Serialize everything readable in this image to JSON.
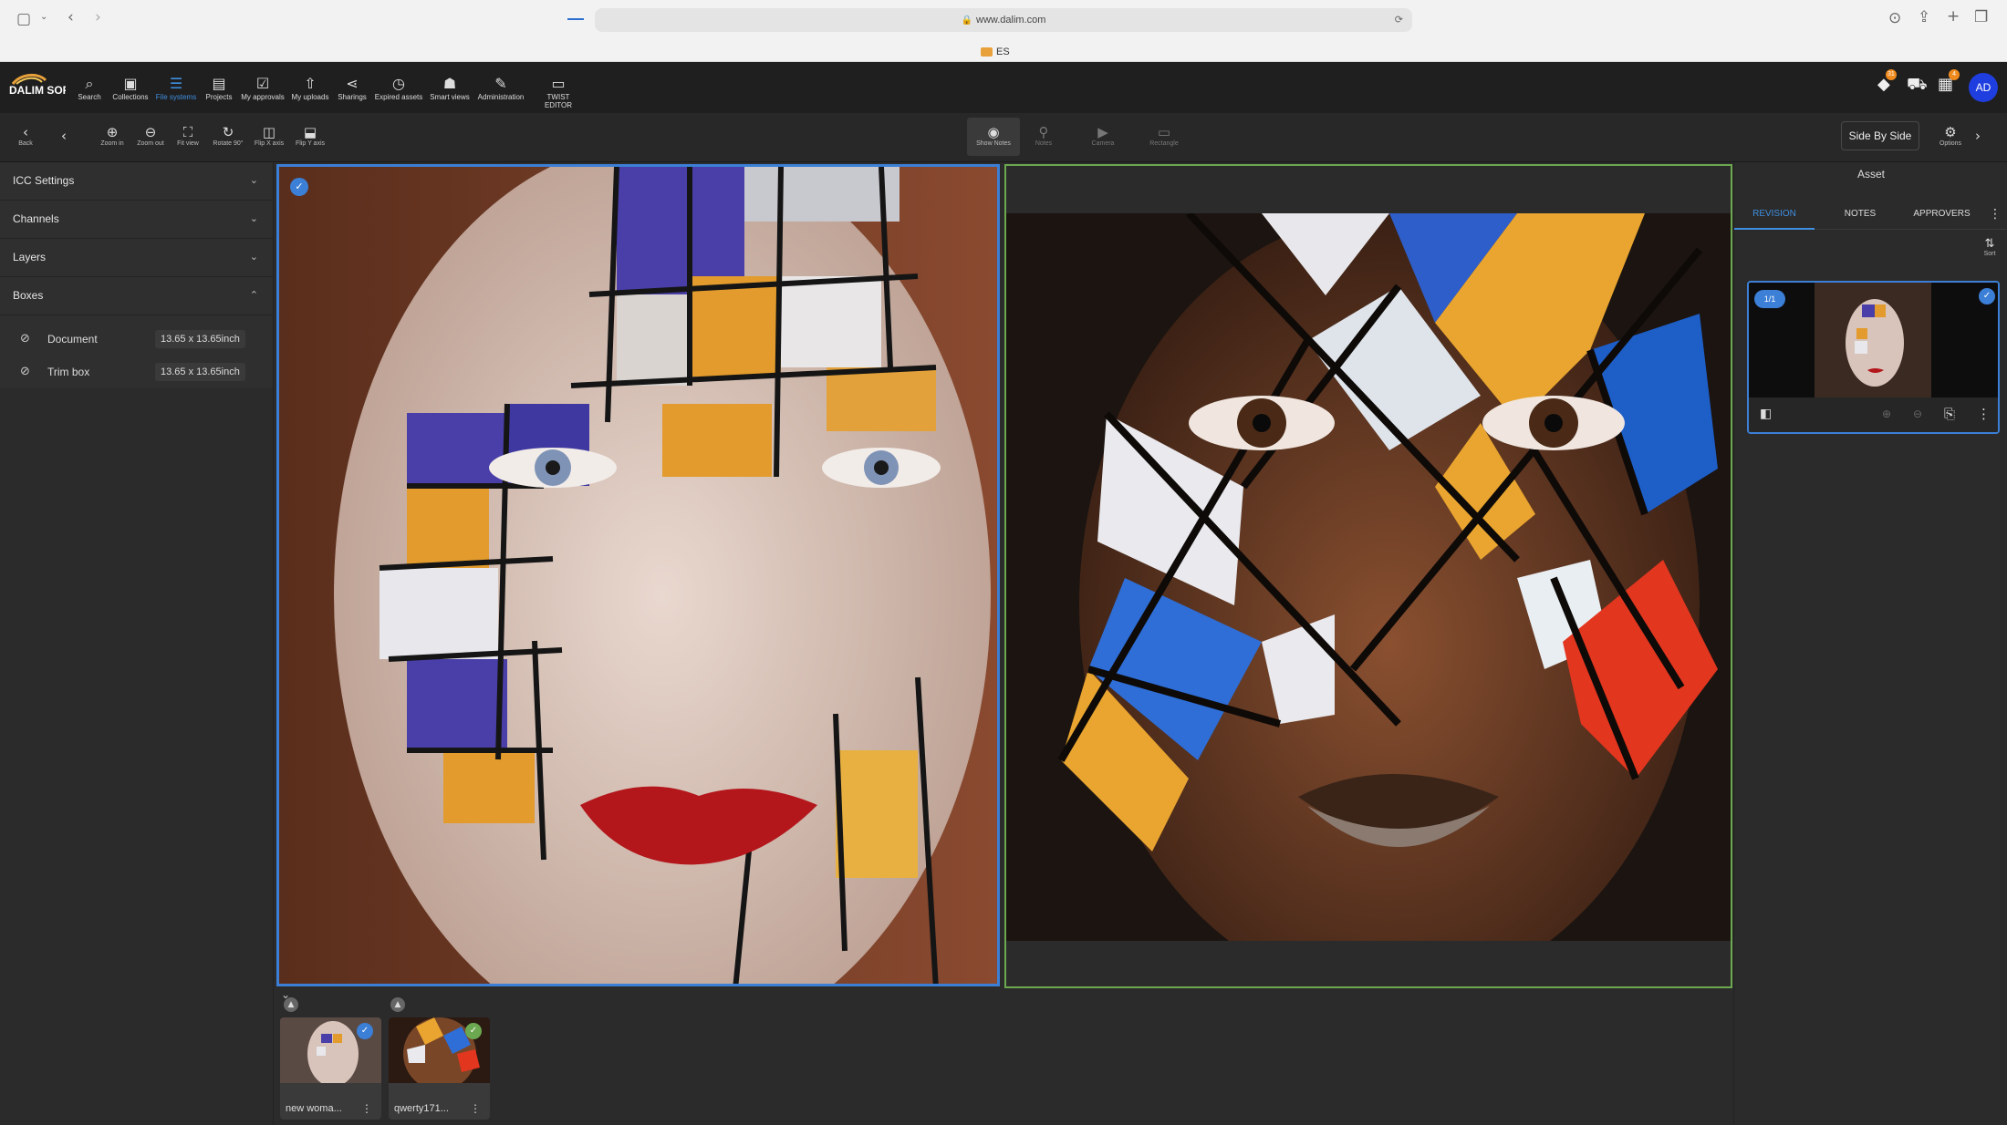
{
  "browser": {
    "url": "www.dalim.com",
    "tab_label": "ES"
  },
  "nav": {
    "logo_text": "DALIM SOFTWARE",
    "items": [
      {
        "label": "Search",
        "icon": "search-icon"
      },
      {
        "label": "Collections",
        "icon": "collections-icon"
      },
      {
        "label": "File systems",
        "icon": "database-icon"
      },
      {
        "label": "Projects",
        "icon": "briefcase-icon"
      },
      {
        "label": "My approvals",
        "icon": "checklist-icon"
      },
      {
        "label": "My uploads",
        "icon": "upload-icon"
      },
      {
        "label": "Sharings",
        "icon": "share-icon"
      },
      {
        "label": "Expired assets",
        "icon": "clock-icon"
      },
      {
        "label": "Smart views",
        "icon": "smart-views-icon"
      },
      {
        "label": "Administration",
        "icon": "wrench-icon"
      },
      {
        "label": "TWIST EDITOR",
        "icon": "monitor-icon"
      }
    ],
    "active_item": "File systems",
    "notifications_count": "31",
    "cart_count": "",
    "tasks_count": "4",
    "avatar": "AD"
  },
  "toolbar": {
    "back": "Back",
    "zoom_in": "Zoom in",
    "zoom_out": "Zoom out",
    "fit_view": "Fit view",
    "rotate": "Rotate 90°",
    "flip_x": "Flip X axis",
    "flip_y": "Flip Y axis",
    "show_notes": "Show Notes",
    "notes": "Notes",
    "camera": "Camera",
    "rectangle": "Rectangle",
    "view_mode": "Side By Side",
    "options": "Options"
  },
  "left_panel": {
    "sections": [
      "ICC Settings",
      "Channels",
      "Layers",
      "Boxes"
    ],
    "boxes": [
      {
        "label": "Document",
        "value": "13.65 x 13.65inch"
      },
      {
        "label": "Trim box",
        "value": "13.65 x 13.65inch"
      }
    ]
  },
  "filmstrip": [
    {
      "name": "new woma...",
      "status": "selected"
    },
    {
      "name": "qwerty171...",
      "status": "compared"
    }
  ],
  "right_panel": {
    "title": "Asset",
    "tabs": [
      "REVISION",
      "NOTES",
      "APPROVERS"
    ],
    "active_tab": "REVISION",
    "sort_label": "Sort",
    "revision_badge": "1/1"
  },
  "colors": {
    "accent": "#3c7fd6",
    "compare": "#6ca84f",
    "badge": "#f08a1c",
    "avatar": "#1f3ee0"
  }
}
